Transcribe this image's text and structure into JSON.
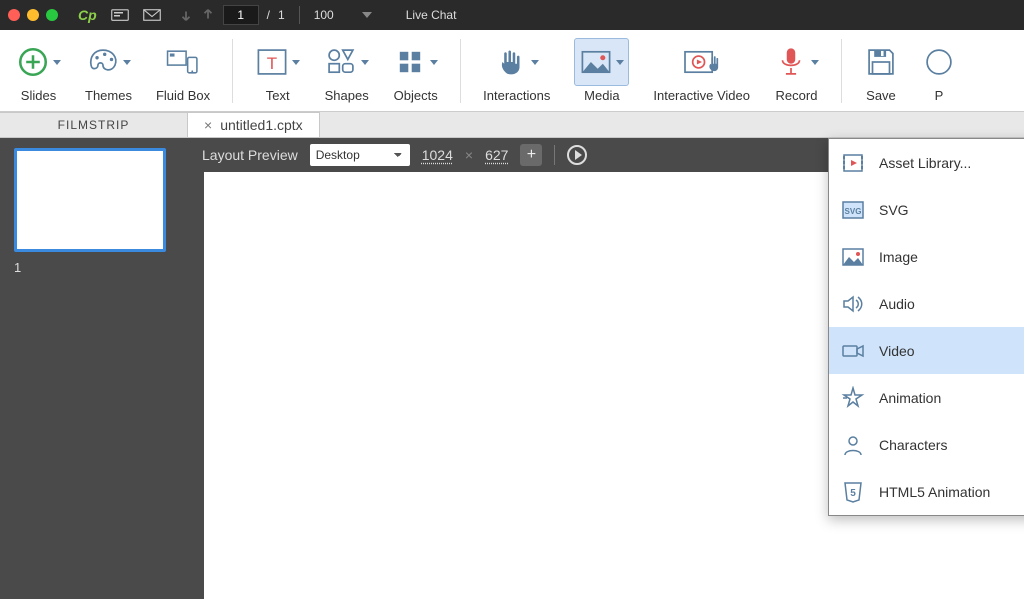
{
  "titlebar": {
    "page_current": "1",
    "page_sep": "/",
    "page_total": "1",
    "zoom": "100",
    "live_chat": "Live Chat"
  },
  "ribbon": {
    "slides": "Slides",
    "themes": "Themes",
    "fluid_box": "Fluid Box",
    "text": "Text",
    "shapes": "Shapes",
    "objects": "Objects",
    "interactions": "Interactions",
    "media": "Media",
    "interactive_video": "Interactive Video",
    "record": "Record",
    "save": "Save",
    "preview_initial": "P"
  },
  "tabs": {
    "filmstrip": "FILMSTRIP",
    "file_name": "untitled1.cptx",
    "close": "×"
  },
  "filmstrip": {
    "thumb1": "1"
  },
  "canvas": {
    "layout_preview": "Layout Preview",
    "device": "Desktop",
    "width": "1024",
    "x": "×",
    "height": "627",
    "plus": "+"
  },
  "media_menu": {
    "asset_library": "Asset Library...",
    "svg": "SVG",
    "svg_badge": "SVG",
    "image": "Image",
    "audio": "Audio",
    "video": "Video",
    "animation": "Animation",
    "characters": "Characters",
    "html5": "HTML5 Animation",
    "html5_badge": "5"
  }
}
